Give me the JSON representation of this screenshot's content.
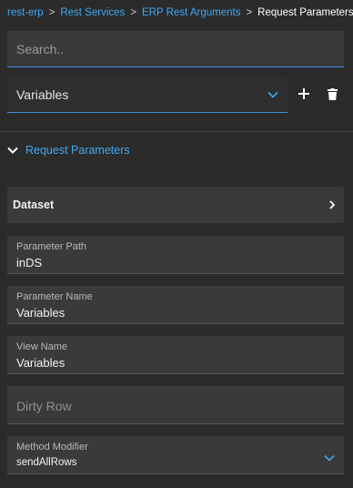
{
  "breadcrumb": {
    "items": [
      "rest-erp",
      "Rest Services",
      "ERP Rest Arguments"
    ],
    "separator": ">",
    "current": "Request Parameters"
  },
  "search": {
    "placeholder": "Search.."
  },
  "variables_select": {
    "value": "Variables"
  },
  "toolbar": {
    "add_icon": "plus-icon",
    "delete_icon": "trash-icon"
  },
  "section": {
    "title": "Request Parameters",
    "expanded": true
  },
  "dataset": {
    "label": "Dataset"
  },
  "fields": {
    "parameter_path": {
      "label": "Parameter Path",
      "value": "inDS"
    },
    "parameter_name": {
      "label": "Parameter Name",
      "value": "Variables"
    },
    "view_name": {
      "label": "View Name",
      "value": "Variables"
    },
    "dirty_row": {
      "placeholder": "Dirty Row"
    },
    "method_modifier": {
      "label": "Method Modifier",
      "value": "sendAllRows"
    }
  },
  "colors": {
    "accent": "#3fa9f5",
    "background": "#2b2b2b",
    "field_bg": "#3a3a3a"
  }
}
